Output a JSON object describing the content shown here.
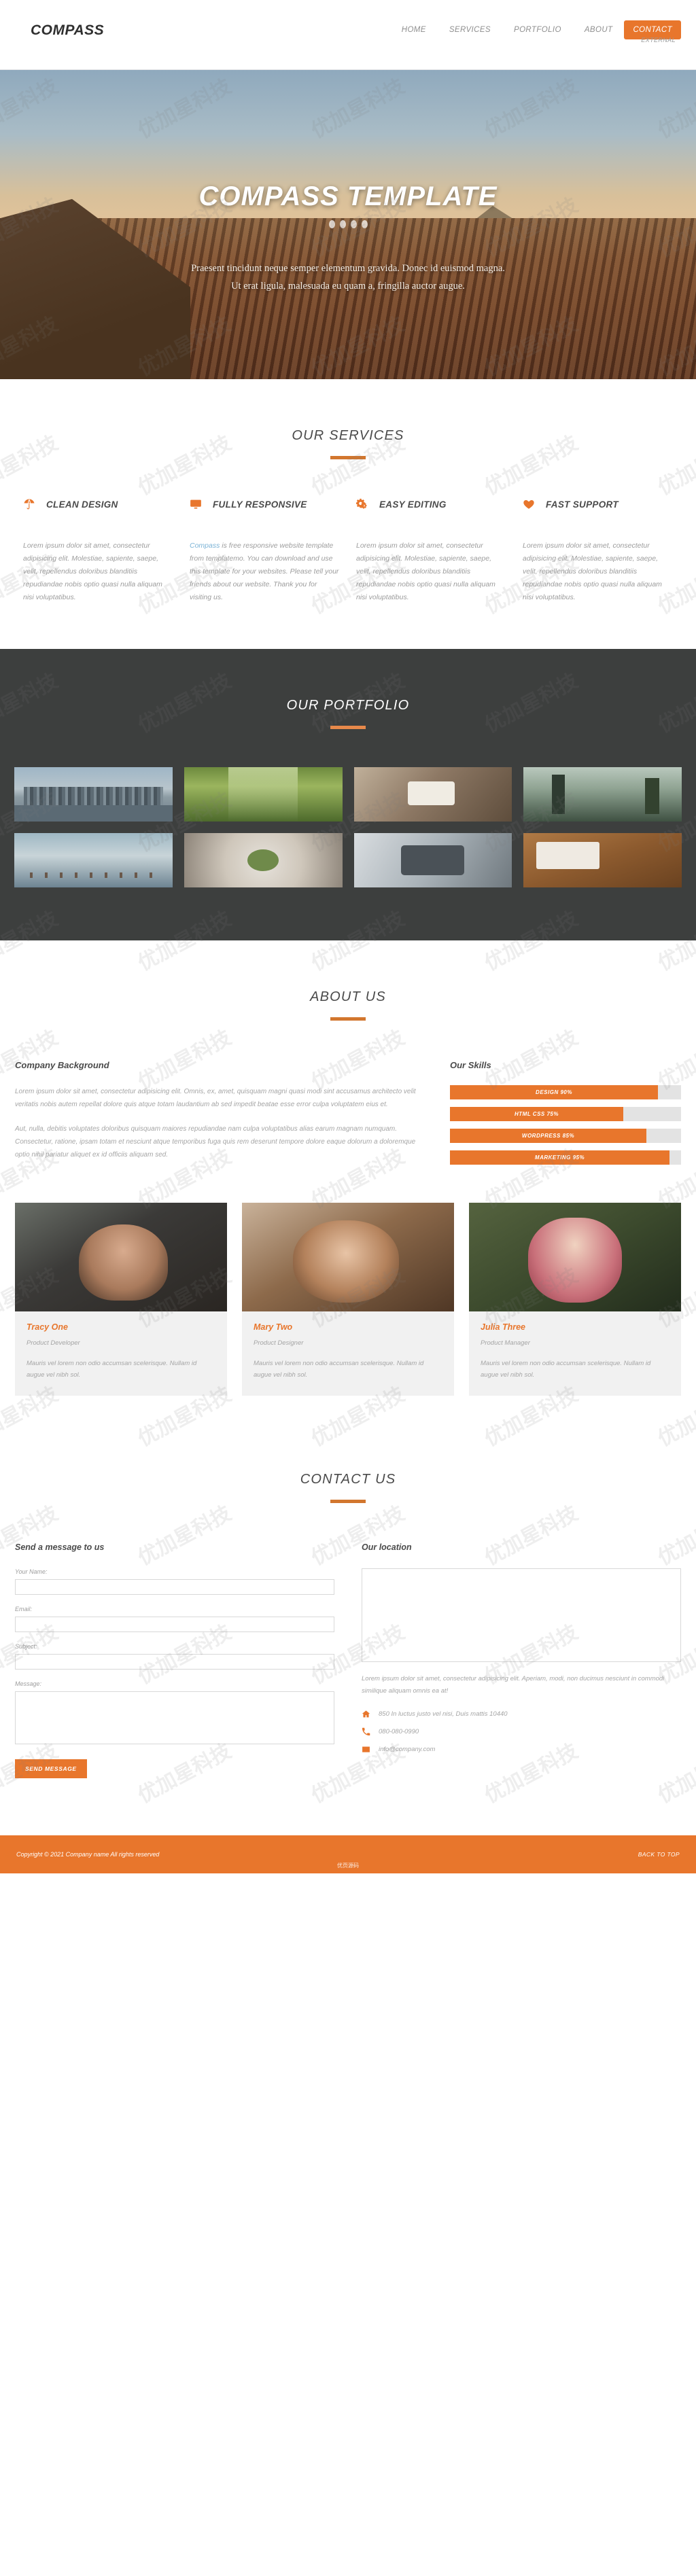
{
  "header": {
    "logo": "COMPASS",
    "nav": [
      {
        "label": "HOME",
        "active": false
      },
      {
        "label": "SERVICES",
        "active": false
      },
      {
        "label": "PORTFOLIO",
        "active": false
      },
      {
        "label": "ABOUT",
        "active": false
      },
      {
        "label": "CONTACT",
        "active": true
      }
    ],
    "sub_label": "EXTERNAL"
  },
  "hero": {
    "title": "COMPASS TEMPLATE",
    "line1": "Praesent tincidunt neque semper elementum gravida. Donec id euismod magna.",
    "line2": "Ut erat ligula, malesuada eu quam a, fringilla auctor augue."
  },
  "services": {
    "heading": "OUR SERVICES",
    "items": [
      {
        "icon": "umbrella-icon",
        "title": "CLEAN DESIGN",
        "body": "Lorem ipsum dolor sit amet, consectetur adipisicing elit. Molestiae, sapiente, saepe, velit, repellendus doloribus blanditiis repudiandae nobis optio quasi nulla aliquam nisi voluptatibus."
      },
      {
        "icon": "monitor-icon",
        "title": "FULLY RESPONSIVE",
        "link": "Compass",
        "body": " is free responsive website template from templatemo. You can download and use this template for your websites. Please tell your friends about our website. Thank you for visiting us."
      },
      {
        "icon": "gears-icon",
        "title": "EASY EDITING",
        "body": "Lorem ipsum dolor sit amet, consectetur adipisicing elit. Molestiae, sapiente, saepe, velit, repellendus doloribus blanditiis repudiandae nobis optio quasi nulla aliquam nisi voluptatibus."
      },
      {
        "icon": "heart-icon",
        "title": "FAST SUPPORT",
        "body": "Lorem ipsum dolor sit amet, consectetur adipisicing elit. Molestiae, sapiente, saepe, velit, repellendus doloribus blanditiis repudiandae nobis optio quasi nulla aliquam nisi voluptatibus."
      }
    ]
  },
  "portfolio": {
    "heading": "OUR PORTFOLIO",
    "items": [
      {
        "name": "city-skyline"
      },
      {
        "name": "green-bridge"
      },
      {
        "name": "desk-coffee"
      },
      {
        "name": "lake-pier"
      },
      {
        "name": "pelican-birds"
      },
      {
        "name": "cactus-pot"
      },
      {
        "name": "smartphone"
      },
      {
        "name": "wooden-desk"
      }
    ]
  },
  "about": {
    "heading": "ABOUT US",
    "company_title": "Company Background",
    "paragraph1": "Lorem ipsum dolor sit amet, consectetur adipisicing elit. Omnis, ex, amet, quisquam magni quasi modi sint accusamus architecto velit veritatis nobis autem repellat dolore quis atque totam laudantium ab sed impedit beatae esse error culpa voluptatem eius et.",
    "paragraph2": "Aut, nulla, debitis voluptates doloribus quisquam maiores repudiandae nam culpa voluptatibus alias earum magnam numquam. Consectetur, ratione, ipsam totam et nesciunt atque temporibus fuga quis rem deserunt tempore dolore eaque dolorum a doloremque optio nihil pariatur aliquet ex id officiis aliquam sed.",
    "skills_title": "Our Skills",
    "skills": [
      {
        "label": "DESIGN 90%",
        "value": 90
      },
      {
        "label": "HTML CSS 75%",
        "value": 75
      },
      {
        "label": "WORDPRESS 85%",
        "value": 85
      },
      {
        "label": "MARKETING 95%",
        "value": 95
      }
    ],
    "team": [
      {
        "name": "Tracy One",
        "role": "Product Developer",
        "desc": "Mauris vel lorem non odio accumsan scelerisque. Nullam id augue vel nibh sol."
      },
      {
        "name": "Mary Two",
        "role": "Product Designer",
        "desc": "Mauris vel lorem non odio accumsan scelerisque. Nullam id augue vel nibh sol."
      },
      {
        "name": "Julia Three",
        "role": "Product Manager",
        "desc": "Mauris vel lorem non odio accumsan scelerisque. Nullam id augue vel nibh sol."
      }
    ]
  },
  "contact": {
    "heading": "CONTACT US",
    "form_title": "Send a message to us",
    "fields": {
      "name_label": "Your Name:",
      "email_label": "Email:",
      "subject_label": "Subject:",
      "message_label": "Message:",
      "name_value": "",
      "email_value": "",
      "subject_value": "",
      "message_value": ""
    },
    "submit_label": "SEND MESSAGE",
    "location_title": "Our location",
    "location_text": "Lorem ipsum dolor sit amet, consectetur adipisicing elit. Aperiam, modi, non ducimus nesciunt in commodi similique aliquam omnis ea at!",
    "details": [
      {
        "icon": "home-icon",
        "text": "850 In luctus justo vel nisi, Duis mattis 10440"
      },
      {
        "icon": "phone-icon",
        "text": "080-080-0990"
      },
      {
        "icon": "mail-icon",
        "text": "info@company.com"
      }
    ]
  },
  "footer": {
    "copyright": "Copyright © 2021 Company name All rights reserved",
    "back_to_top": "BACK TO TOP",
    "credit": "优页源码"
  },
  "watermark": {
    "text": "优加星科技"
  },
  "colors": {
    "accent": "#e8762c",
    "dark": "#3d3f3e",
    "heading": "#4a4a4a"
  }
}
